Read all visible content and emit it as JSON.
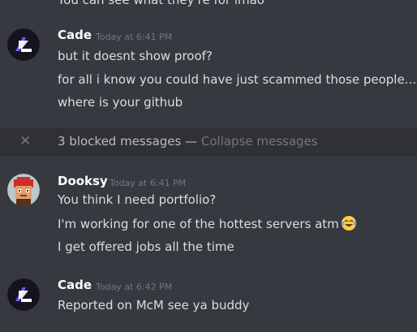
{
  "top_cutoff_text": "You can see what they're for lmao",
  "messages": [
    {
      "author": "Cade",
      "time": "Today at 6:41 PM",
      "lines": [
        "but it doesnt show proof?",
        "for all i know you could have just scammed those people...",
        "where is your github"
      ],
      "name_color": "#ffffff"
    },
    {
      "author": "Dooksy",
      "time": "Today at 6:41 PM",
      "lines": [
        "You think I need portfolio?",
        "I'm working for one of the hottest servers atm",
        "I get offered jobs all the time"
      ],
      "emoji": "joy-emoji",
      "name_color": "#ffffff"
    },
    {
      "author": "Cade",
      "time": "Today at 6:42 PM",
      "lines": [
        "Reported on McM see ya buddy"
      ],
      "name_color": "#ffffff"
    }
  ],
  "blocked": {
    "icon": "close-icon",
    "text": "3 blocked messages",
    "separator": " — ",
    "action": "Collapse messages"
  },
  "colors": {
    "background": "#36393f",
    "blocked_bar": "#2f3136",
    "text": "#dcddde",
    "muted": "#72767d"
  }
}
